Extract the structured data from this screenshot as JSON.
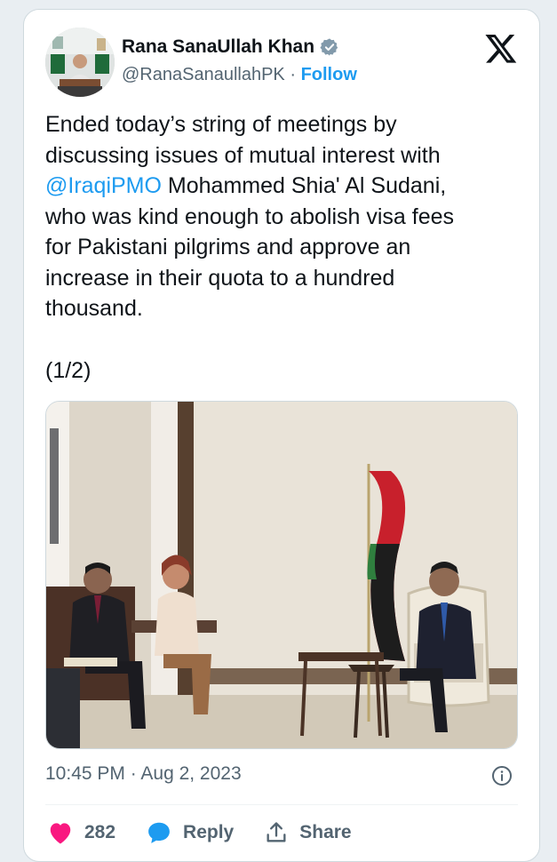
{
  "author": {
    "name": "Rana SanaUllah Khan",
    "handle": "@RanaSanaullahPK",
    "separator": "·",
    "follow_label": "Follow"
  },
  "tweet": {
    "text_before": "Ended today’s string of meetings by\ndiscussing issues of mutual interest with\n",
    "mention": "@IraqiPMO",
    "text_after": " Mohammed Shia' Al Sudani,\nwho was kind enough to abolish visa fees\nfor Pakistani pilgrims and approve an\nincrease in their quota to a hundred\nthousand.",
    "part": "(1/2)"
  },
  "timestamp": "10:45 PM · Aug 2, 2023",
  "actions": {
    "like_count": "282",
    "reply_label": "Reply",
    "share_label": "Share"
  },
  "icons": {
    "x_logo": "x-logo-icon",
    "verified": "verified-badge-icon",
    "info": "info-icon",
    "like": "heart-icon",
    "reply": "comment-icon",
    "share": "share-icon"
  },
  "colors": {
    "accent": "#1d9bf0",
    "heart": "#f91880",
    "text": "#0f1419",
    "muted": "#536471"
  }
}
